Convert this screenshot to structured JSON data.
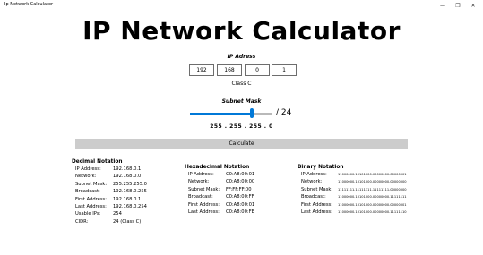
{
  "window": {
    "title": "Ip Network Calculator",
    "minimize": "—",
    "maximize": "❐",
    "close": "✕"
  },
  "header": {
    "title": "IP Network Calculator"
  },
  "ip": {
    "label": "IP Adress",
    "octets": [
      "192",
      "168",
      "0",
      "1"
    ],
    "class_text": "Class C"
  },
  "mask": {
    "label": "Subnet Mask",
    "cidr": "/ 24",
    "slider_fraction": 0.75,
    "octets_text": "255 . 255 . 255 . 0"
  },
  "calculate": {
    "label": "Calculate"
  },
  "decimal": {
    "title": "Decimal Notation",
    "rows": [
      {
        "key": "IP Address:",
        "val": "192.168.0.1"
      },
      {
        "key": "Network:",
        "val": "192.168.0.0"
      },
      {
        "key": "Subnet Mask:",
        "val": "255.255.255.0"
      },
      {
        "key": "Broadcast:",
        "val": "192.168.0.255"
      },
      {
        "key": "First Address:",
        "val": "192.168.0.1"
      },
      {
        "key": "Last Address:",
        "val": "192.168.0.254"
      },
      {
        "key": "Usable IPs:",
        "val": "254"
      },
      {
        "key": "CIDR:",
        "val": "24 (Class C)"
      }
    ]
  },
  "hex": {
    "title": "Hexadecimal Notation",
    "rows": [
      {
        "key": "IP Address:",
        "val": "C0:A8:00:01"
      },
      {
        "key": "Network:",
        "val": "C0:A8:00:00"
      },
      {
        "key": "Subnet Mask:",
        "val": "FF:FF:FF:00"
      },
      {
        "key": "Broadcast:",
        "val": "C0:A8:00:FF"
      },
      {
        "key": "First Address:",
        "val": "C0:A8:00:01"
      },
      {
        "key": "Last Address:",
        "val": "C0:A8:00:FE"
      }
    ]
  },
  "binary": {
    "title": "Binary Notation",
    "rows": [
      {
        "key": "IP Address:",
        "val": "11000000.10101000.00000000.00000001"
      },
      {
        "key": "Network:",
        "val": "11000000.10101000.00000000.00000000"
      },
      {
        "key": "Subnet Mask:",
        "val": "11111111.11111111.11111111.00000000"
      },
      {
        "key": "Broadcast:",
        "val": "11000000.10101000.00000000.11111111"
      },
      {
        "key": "First Address:",
        "val": "11000000.10101000.00000000.00000001"
      },
      {
        "key": "Last Address:",
        "val": "11000000.10101000.00000000.11111110"
      }
    ]
  }
}
